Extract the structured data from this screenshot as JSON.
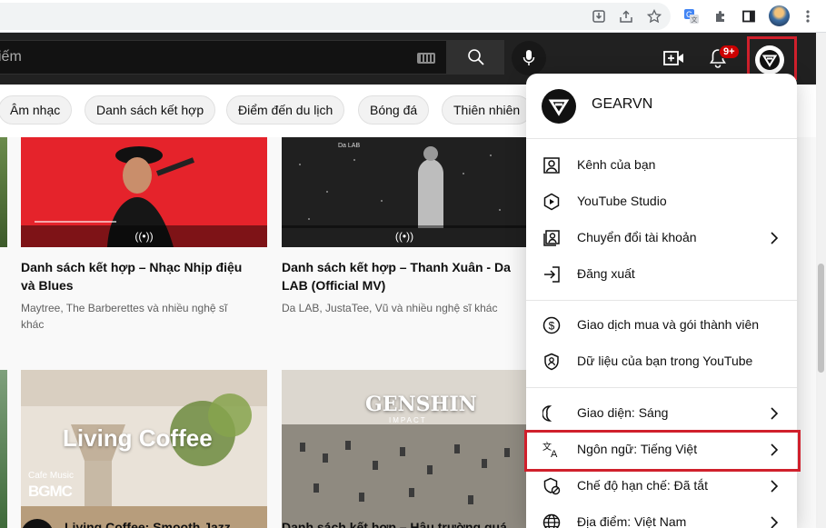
{
  "search": {
    "placeholder_tail": "iếm"
  },
  "notifications": {
    "badge": "9+"
  },
  "chips": [
    "Âm nhạc",
    "Danh sách kết hợp",
    "Điểm đến du lịch",
    "Bóng đá",
    "Thiên nhiên"
  ],
  "videos": [
    {
      "title": "Danh sách kết hợp – Nhạc Nhịp điệu và Blues",
      "meta": "Maytree, The Barberettes và nhiều nghệ sĩ khác",
      "live": "((•))"
    },
    {
      "title": "Danh sách kết hợp – Thanh Xuân - Da LAB (Official MV)",
      "meta": "Da LAB, JustaTee, Vũ và nhiều nghệ sĩ khác",
      "live": "((•))",
      "thumb_caption": "Da LAB"
    },
    {
      "title": "Living Coffee: Smooth Jazz",
      "thumb_text": "Living Coffee",
      "thumb_small": "Cafe Music",
      "thumb_logo": "BGMC"
    },
    {
      "title": "Danh sách kết hợp – Hậu trường quá",
      "thumb_text": "GENSHIN",
      "thumb_small": "IMPACT"
    }
  ],
  "menu": {
    "account_name": "GEARVN",
    "sections": [
      [
        {
          "label": "Kênh của bạn",
          "icon": "account-box-icon",
          "chevron": false
        },
        {
          "label": "YouTube Studio",
          "icon": "studio-icon",
          "chevron": false
        },
        {
          "label": "Chuyển đổi tài khoản",
          "icon": "switch-account-icon",
          "chevron": true
        },
        {
          "label": "Đăng xuất",
          "icon": "sign-out-icon",
          "chevron": false
        }
      ],
      [
        {
          "label": "Giao dịch mua và gói thành viên",
          "icon": "dollar-icon",
          "chevron": false
        },
        {
          "label": "Dữ liệu của bạn trong YouTube",
          "icon": "shield-user-icon",
          "chevron": false
        }
      ],
      [
        {
          "label": "Giao diện: Sáng",
          "icon": "moon-icon",
          "chevron": true
        },
        {
          "label": "Ngôn ngữ: Tiếng Việt",
          "icon": "translate-icon",
          "chevron": true
        },
        {
          "label": "Chế độ hạn chế: Đã tắt",
          "icon": "restricted-icon",
          "chevron": true
        },
        {
          "label": "Địa điểm: Việt Nam",
          "icon": "globe-icon",
          "chevron": true
        }
      ]
    ]
  },
  "colors": {
    "highlight": "#d0202c",
    "topbar": "#212121",
    "badge": "#cc0000"
  }
}
